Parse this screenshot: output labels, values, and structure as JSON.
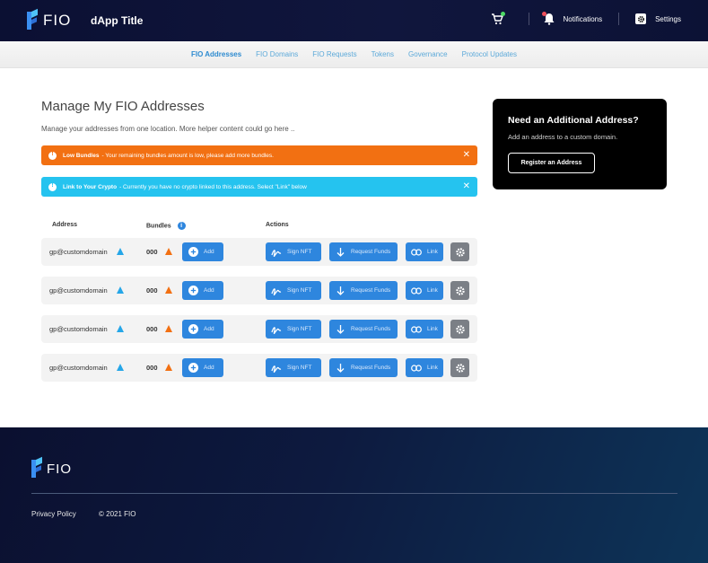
{
  "header": {
    "logo_text": "FIO",
    "app_title": "dApp Title",
    "notifications_label": "Notifications",
    "settings_label": "Settings"
  },
  "nav": {
    "items": [
      {
        "label": "FIO Addresses",
        "active": true
      },
      {
        "label": "FIO Domains",
        "active": false
      },
      {
        "label": "FIO Requests",
        "active": false
      },
      {
        "label": "Tokens",
        "active": false
      },
      {
        "label": "Governance",
        "active": false
      },
      {
        "label": "Protocol Updates",
        "active": false
      }
    ]
  },
  "main": {
    "title": "Manage My FIO Addresses",
    "subtitle": "Manage your addresses from one location. More helper content could go here ..",
    "alerts": [
      {
        "type": "warning",
        "title": "Low Bundles",
        "message": " - Your remaining bundles amount is low, please add more bundles.",
        "color": "#f27012"
      },
      {
        "type": "info",
        "title": "Link to Your Crypto",
        "message": " - Currently you have no crypto linked to this address. Select \"Link\" below",
        "color": "#25c3ef"
      }
    ],
    "table": {
      "headers": {
        "address": "Address",
        "bundles": "Bundles",
        "actions": "Actions"
      },
      "rows": [
        {
          "address": "gp@customdomain",
          "bundles": "000"
        },
        {
          "address": "gp@customdomain",
          "bundles": "000"
        },
        {
          "address": "gp@customdomain",
          "bundles": "000"
        },
        {
          "address": "gp@customdomain",
          "bundles": "000"
        }
      ],
      "buttons": {
        "add": "Add",
        "sign_nft": "Sign NFT",
        "request_funds": "Request Funds",
        "link": "Link"
      }
    }
  },
  "side_card": {
    "title": "Need an Additional Address?",
    "subtitle": "Add an address to a custom domain.",
    "button": "Register an Address"
  },
  "footer": {
    "logo_text": "FIO",
    "privacy_label": "Privacy Policy",
    "copyright": "© 2021 FIO"
  },
  "colors": {
    "accent": "#2e86de",
    "warning": "#f27012",
    "info": "#25c3ef",
    "header_bg": "#0b1033"
  }
}
